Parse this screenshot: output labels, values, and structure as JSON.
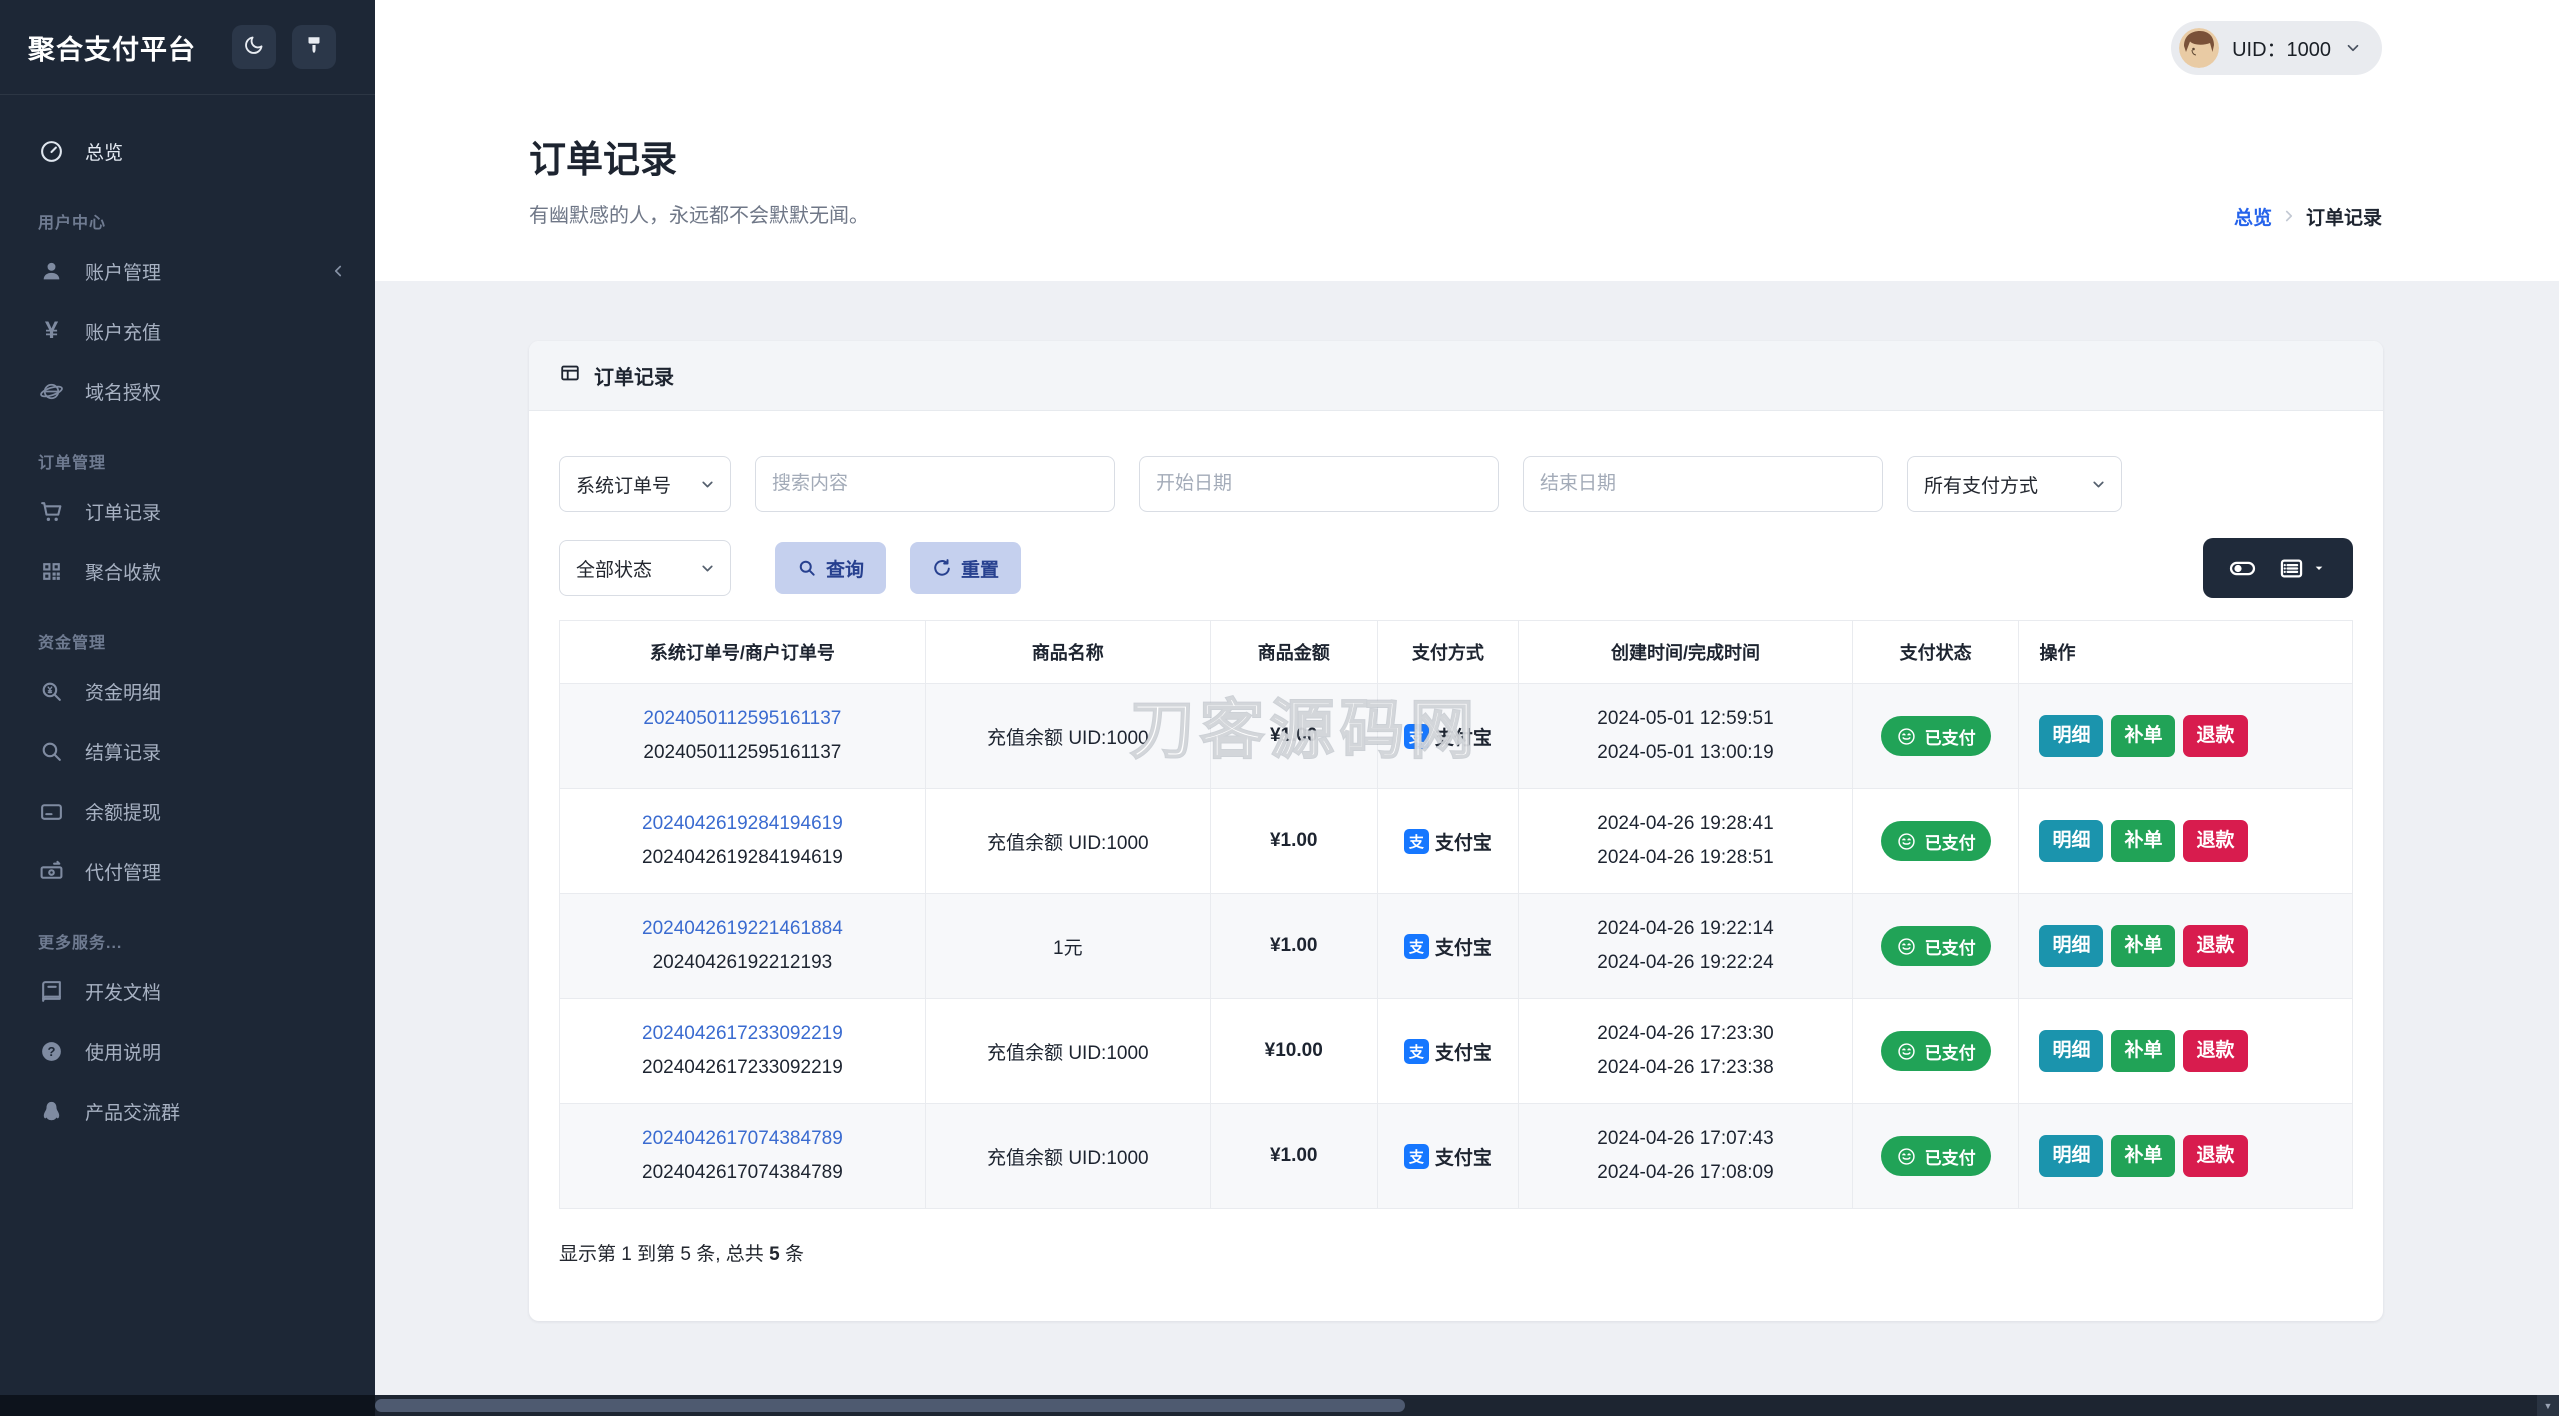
{
  "app": {
    "title": "聚合支付平台"
  },
  "topbar": {
    "uid": "UID：1000"
  },
  "sidebar": {
    "sections": [
      {
        "items": [
          {
            "label": "总览",
            "icon": "gauge-icon"
          }
        ]
      },
      {
        "label": "用户中心",
        "items": [
          {
            "label": "账户管理",
            "icon": "user-icon"
          },
          {
            "label": "账户充值",
            "icon": "yen-icon"
          },
          {
            "label": "域名授权",
            "icon": "globe-icon"
          }
        ]
      },
      {
        "label": "订单管理",
        "items": [
          {
            "label": "订单记录",
            "icon": "cart-icon"
          },
          {
            "label": "聚合收款",
            "icon": "qrcode-icon"
          }
        ]
      },
      {
        "label": "资金管理",
        "items": [
          {
            "label": "资金明细",
            "icon": "fund-search-icon"
          },
          {
            "label": "结算记录",
            "icon": "search-icon"
          },
          {
            "label": "余额提现",
            "icon": "bankcard-icon"
          },
          {
            "label": "代付管理",
            "icon": "transfer-icon"
          }
        ]
      },
      {
        "label": "更多服务...",
        "items": [
          {
            "label": "开发文档",
            "icon": "book-icon"
          },
          {
            "label": "使用说明",
            "icon": "help-icon"
          },
          {
            "label": "产品交流群",
            "icon": "qq-icon"
          }
        ]
      }
    ]
  },
  "page": {
    "title": "订单记录",
    "subtitle": "有幽默感的人，永远都不会默默无闻。",
    "breadcrumb": [
      "总览",
      "订单记录"
    ]
  },
  "card": {
    "title": "订单记录",
    "filters": {
      "order_type": "系统订单号",
      "search_placeholder": "搜索内容",
      "start_date_placeholder": "开始日期",
      "end_date_placeholder": "结束日期",
      "pay_method": "所有支付方式",
      "status": "全部状态",
      "query": "查询",
      "reset": "重置"
    },
    "table": {
      "columns": [
        "系统订单号/商户订单号",
        "商品名称",
        "商品金额",
        "支付方式",
        "创建时间/完成时间",
        "支付状态",
        "操作"
      ],
      "actions": {
        "detail": "明细",
        "reissue": "补单",
        "refund": "退款"
      },
      "alipay_glyph": "支",
      "rows": [
        {
          "sys_no": "2024050112595161137",
          "merchant_no": "2024050112595161137",
          "product": "充值余额 UID:1000",
          "amount": "¥1.00",
          "method": "支付宝",
          "created": "2024-05-01 12:59:51",
          "completed": "2024-05-01 13:00:19",
          "status": "已支付"
        },
        {
          "sys_no": "2024042619284194619",
          "merchant_no": "2024042619284194619",
          "product": "充值余额 UID:1000",
          "amount": "¥1.00",
          "method": "支付宝",
          "created": "2024-04-26 19:28:41",
          "completed": "2024-04-26 19:28:51",
          "status": "已支付"
        },
        {
          "sys_no": "2024042619221461884",
          "merchant_no": "20240426192212193",
          "product": "1元",
          "amount": "¥1.00",
          "method": "支付宝",
          "created": "2024-04-26 19:22:14",
          "completed": "2024-04-26 19:22:24",
          "status": "已支付"
        },
        {
          "sys_no": "2024042617233092219",
          "merchant_no": "2024042617233092219",
          "product": "充值余额 UID:1000",
          "amount": "¥10.00",
          "method": "支付宝",
          "created": "2024-04-26 17:23:30",
          "completed": "2024-04-26 17:23:38",
          "status": "已支付"
        },
        {
          "sys_no": "2024042617074384789",
          "merchant_no": "2024042617074384789",
          "product": "充值余额 UID:1000",
          "amount": "¥1.00",
          "method": "支付宝",
          "created": "2024-04-26 17:07:43",
          "completed": "2024-04-26 17:08:09",
          "status": "已支付"
        }
      ]
    },
    "footer": {
      "prefix": "显示第 1 到第 5 条, 总共 ",
      "total": "5",
      "suffix": " 条"
    }
  },
  "watermark": "刀客源码网",
  "colors": {
    "sidebar_bg": "#1d2736",
    "accent_blue": "#2563eb",
    "link_blue": "#3a6bd0",
    "success_green": "#21a357",
    "teal": "#1b94ad",
    "danger_red": "#d81c4e",
    "alipay_blue": "#1677ff",
    "soft_button_bg": "#c5d0ee",
    "soft_button_text": "#27408f"
  }
}
